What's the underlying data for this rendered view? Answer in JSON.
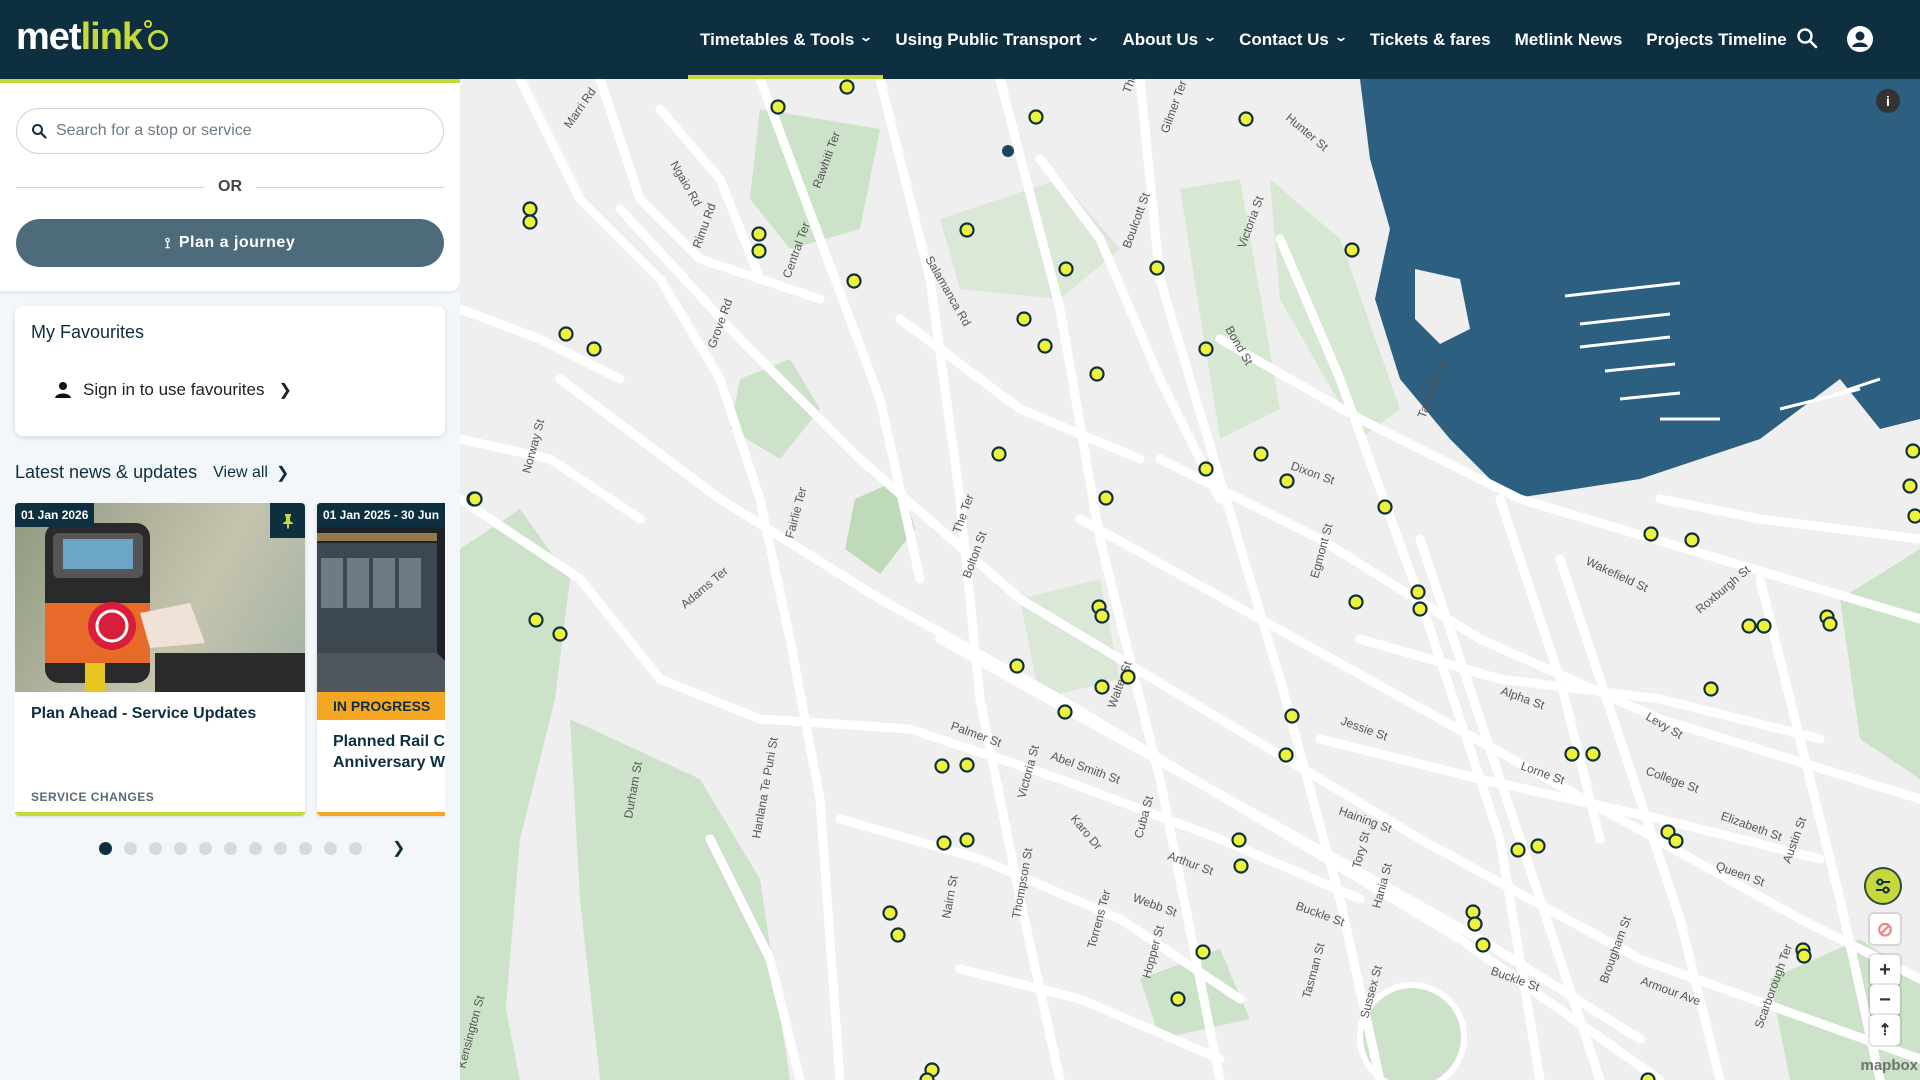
{
  "header": {
    "logo_met": "met",
    "logo_link": "link",
    "nav": [
      {
        "label": "Timetables & Tools",
        "dropdown": true,
        "active": true
      },
      {
        "label": "Using Public Transport",
        "dropdown": true
      },
      {
        "label": "About Us",
        "dropdown": true
      },
      {
        "label": "Contact Us",
        "dropdown": true
      },
      {
        "label": "Tickets & fares",
        "dropdown": false
      },
      {
        "label": "Metlink News",
        "dropdown": false
      },
      {
        "label": "Projects Timeline",
        "dropdown": false
      }
    ],
    "icons": [
      "search-icon",
      "account-icon"
    ]
  },
  "search": {
    "placeholder": "Search for a stop or service",
    "or_label": "OR",
    "plan_label": "Plan a journey"
  },
  "favourites": {
    "title": "My Favourites",
    "signin_label": "Sign in to use favourites"
  },
  "news": {
    "title": "Latest news & updates",
    "view_all": "View all",
    "cards": [
      {
        "date": "01 Jan 2026",
        "heading": "Plan Ahead - Service Updates",
        "category": "SERVICE CHANGES",
        "pinned": true
      },
      {
        "date": "01 Jan 2025 - 30 Jun",
        "badge": "IN PROGRESS",
        "heading": "Planned Rail Closures Anniversary Weekend"
      }
    ],
    "pager_count": 11,
    "pager_active": 0
  },
  "map": {
    "streets": [
      "Marri Rd",
      "Ngaio Rd",
      "Rimu Rd",
      "Rawhiti Ter",
      "Salamanca Rd",
      "Central Ter",
      "Grove Rd",
      "Boulcott St",
      "Gilmer Ter",
      "The Ter",
      "Hunter St",
      "Victoria St",
      "Bond St",
      "Taranaki St",
      "Norway St",
      "Fairlie Ter",
      "Adams Ter",
      "The Ter",
      "Bolton St",
      "Dixon St",
      "Egmont St",
      "Wakefield St",
      "Roxburgh St",
      "Alpha St",
      "Levy St",
      "Jessie St",
      "Lorne St",
      "College St",
      "Palmer St",
      "Abel Smith St",
      "Walter St",
      "Victoria St",
      "Karo Dr",
      "Cuba St",
      "Haining St",
      "Tory St",
      "Elizabeth St",
      "Queen St",
      "Austin St",
      "Durham St",
      "Hanlana Te Puni St",
      "Arthur St",
      "Webb St",
      "Buckle St",
      "Hania St",
      "Nairn St",
      "Thompson St",
      "Torrens Ter",
      "Hopper St",
      "Tasman St",
      "Sussex St",
      "Buckle St",
      "Brougham St",
      "Armour Ave",
      "Scarborough Ter",
      "Kensington St"
    ],
    "attribution": "mapbox"
  },
  "colors": {
    "header_bg": "#0d2f3f",
    "accent": "#c5d93c",
    "button": "#4d6b7a",
    "water": "#2c5f80",
    "park": "#cde3c9"
  }
}
